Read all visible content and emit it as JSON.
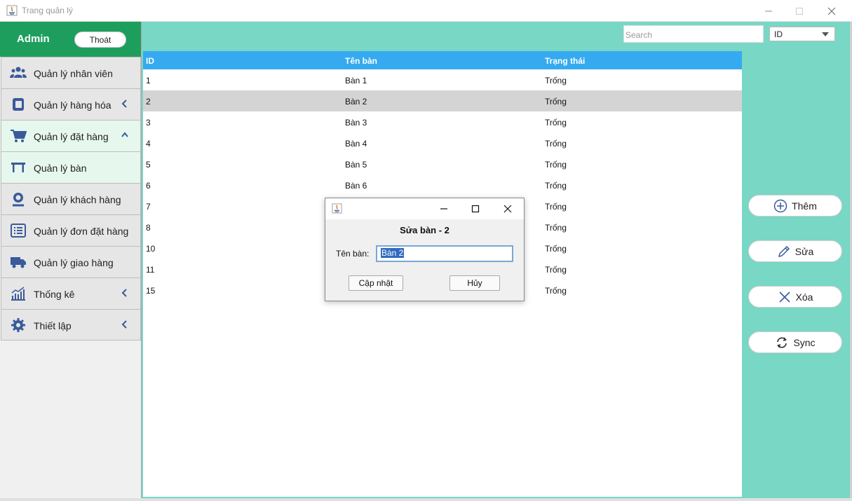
{
  "window": {
    "title": "Trang quản lý"
  },
  "sidebar": {
    "user": "Admin",
    "logout": "Thoát",
    "items": [
      {
        "label": "Quản lý nhân viên",
        "icon": "users-icon"
      },
      {
        "label": "Quản lý hàng hóa",
        "icon": "box-icon",
        "chevron": "left"
      },
      {
        "label": "Quản lý đặt hàng",
        "icon": "cart-icon",
        "chevron": "up"
      },
      {
        "label": "Quản lý bàn",
        "icon": "table-icon"
      },
      {
        "label": "Quản lý khách hàng",
        "icon": "customer-icon"
      },
      {
        "label": "Quản lý đơn đặt hàng",
        "icon": "order-list-icon"
      },
      {
        "label": "Quản lý giao hàng",
        "icon": "truck-icon"
      },
      {
        "label": "Thống kê",
        "icon": "chart-icon",
        "chevron": "left"
      },
      {
        "label": "Thiết lập",
        "icon": "gear-icon",
        "chevron": "left"
      }
    ]
  },
  "toolbar": {
    "search_placeholder": "Search",
    "filter_selected": "ID"
  },
  "table": {
    "headers": [
      "ID",
      "Tên bàn",
      "Trạng thái"
    ],
    "rows": [
      [
        "1",
        "Bàn 1",
        "Trống"
      ],
      [
        "2",
        "Bàn 2",
        "Trống"
      ],
      [
        "3",
        "Bàn 3",
        "Trống"
      ],
      [
        "4",
        "Bàn 4",
        "Trống"
      ],
      [
        "5",
        "Bàn 5",
        "Trống"
      ],
      [
        "6",
        "Bàn 6",
        "Trống"
      ],
      [
        "7",
        "",
        "Trống"
      ],
      [
        "8",
        "",
        "Trống"
      ],
      [
        "10",
        "",
        "Trống"
      ],
      [
        "11",
        "",
        "Trống"
      ],
      [
        "15",
        "",
        "Trống"
      ]
    ],
    "selected_row": 1
  },
  "actions": {
    "add": "Thêm",
    "edit": "Sửa",
    "delete": "Xóa",
    "sync": "Sync"
  },
  "dialog": {
    "heading": "Sửa bàn - 2",
    "field_label": "Tên bàn:",
    "field_value": "Bàn 2",
    "update": "Cập nhật",
    "cancel": "Hủy"
  },
  "colors": {
    "sidebar_header": "#1e9e5d",
    "content_bg": "#78d7c5",
    "table_header": "#36aaf0",
    "icon": "#3a5a9a"
  }
}
